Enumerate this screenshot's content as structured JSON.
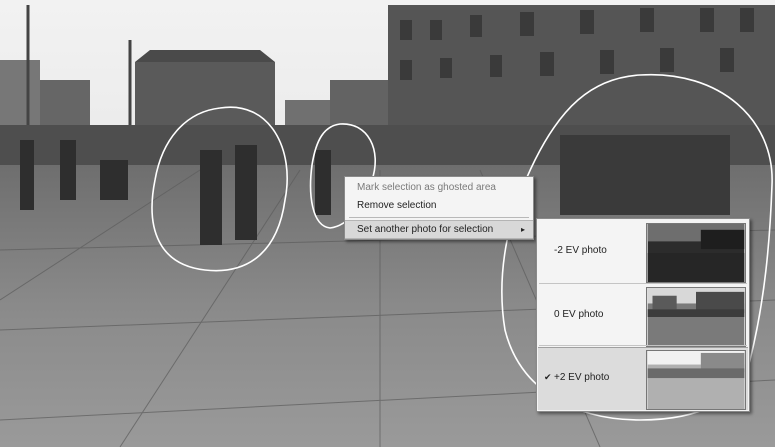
{
  "context_menu": {
    "items": [
      {
        "label": "Mark selection as ghosted area",
        "enabled": false
      },
      {
        "label": "Remove selection",
        "enabled": true
      },
      {
        "label": "Set another photo for selection",
        "enabled": true,
        "has_submenu": true
      }
    ],
    "submenu_arrow": "▸"
  },
  "submenu": {
    "items": [
      {
        "label": "-2 EV photo",
        "checked": false
      },
      {
        "label": "0 EV photo",
        "checked": false
      },
      {
        "label": "+2 EV photo",
        "checked": true
      }
    ],
    "check_glyph": "✔"
  },
  "icons": [
    "submenu-arrow-icon",
    "checkmark-icon"
  ]
}
